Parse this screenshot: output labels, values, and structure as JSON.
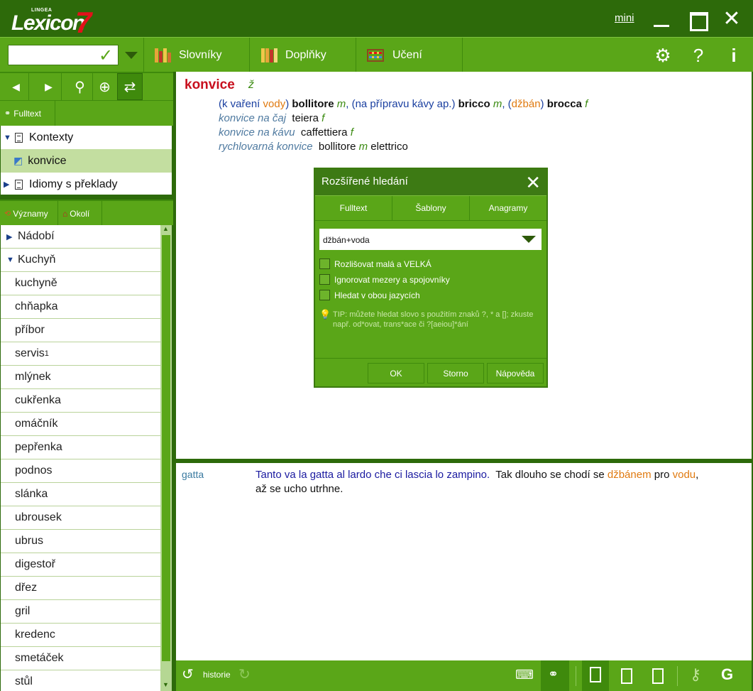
{
  "window": {
    "logo_brand": "LINGEA",
    "logo_name": "Lexicon",
    "logo_version": "7",
    "mini_label": "mini",
    "close_glyph": "✕"
  },
  "toolbar": {
    "search_value": "",
    "dictionaries_label": "Slovníky",
    "addons_label": "Doplňky",
    "learning_label": "Učení",
    "settings_icon": "gear-icon",
    "help_label": "?",
    "info_label": "i"
  },
  "left": {
    "fulltext_tab": "Fulltext",
    "contexts": [
      {
        "label": "Kontexty",
        "state": "expanded"
      },
      {
        "label": "konvice",
        "state": "selected"
      },
      {
        "label": "Idiomy s překlady",
        "state": "collapsed"
      }
    ],
    "meanings_tab": "Významy",
    "surroundings_tab": "Okolí",
    "words": [
      {
        "label": "Nádobí",
        "type": "category",
        "expanded": false
      },
      {
        "label": "Kuchyň",
        "type": "category",
        "expanded": true
      },
      {
        "label": "kuchyně"
      },
      {
        "label": "chňapka"
      },
      {
        "label": "příbor"
      },
      {
        "label": "servis",
        "sup": "1"
      },
      {
        "label": "mlýnek"
      },
      {
        "label": "cukřenka"
      },
      {
        "label": "omáčník"
      },
      {
        "label": "pepřenka"
      },
      {
        "label": "podnos"
      },
      {
        "label": "slánka"
      },
      {
        "label": "ubrousek"
      },
      {
        "label": "ubrus"
      },
      {
        "label": "digestoř"
      },
      {
        "label": "dřez"
      },
      {
        "label": "gril"
      },
      {
        "label": "kredenc"
      },
      {
        "label": "smetáček"
      },
      {
        "label": "stůl"
      }
    ]
  },
  "entry": {
    "headword": "konvice",
    "gender": "ž",
    "line1": {
      "p1": "(k vaření ",
      "p2": "vody",
      "p3": ") ",
      "w1": "bollitore",
      "g1": "m",
      "p4": ", (na přípravu kávy ap.) ",
      "w2": "bricco",
      "g2": "m",
      "p5": ", (",
      "p6": "džbán",
      "p7": ") ",
      "w3": "brocca",
      "g3": "f"
    },
    "phrases": [
      {
        "phrase": "konvice na čaj",
        "translation": "teiera",
        "gender": "f",
        "extra": ""
      },
      {
        "phrase": "konvice na kávu",
        "translation": "caffettiera",
        "gender": "f",
        "extra": ""
      },
      {
        "phrase": "rychlovarná konvice",
        "translation": "bollitore",
        "gender": "m",
        "extra": "elettrico"
      }
    ]
  },
  "result": {
    "keyword": "gatta",
    "italian": "Tanto va la gatta al lardo che ci lascia lo zampino.",
    "czech_1": "Tak dlouho se chodí se ",
    "czech_hl1": "džbánem",
    "czech_2": " pro ",
    "czech_hl2": "vodu",
    "czech_3": ",",
    "czech_line2": "až se ucho utrhne."
  },
  "dialog": {
    "title": "Rozšířené hledání",
    "close_glyph": "✕",
    "tabs": [
      "Fulltext",
      "Šablony",
      "Anagramy"
    ],
    "active_tab": "Šablony",
    "query": "džbán+voda",
    "options": [
      {
        "label": "Rozlišovat malá a VELKÁ",
        "checked": false
      },
      {
        "label": "Ignorovat mezery a spojovníky",
        "checked": false
      },
      {
        "label": "Hledat v obou jazycích",
        "checked": false
      }
    ],
    "tip": "TIP: můžete hledat slovo s použitím znaků ?, * a []; zkuste např. od*ovat, trans*ace či ?[aeiou]*ání",
    "ok_label": "OK",
    "cancel_label": "Storno",
    "help_label": "Nápověda"
  },
  "bottom": {
    "history_label": "historie",
    "g_label": "G"
  },
  "colors": {
    "frame": "#2d6a0a",
    "toolbar": "#5aa618",
    "headword": "#c8101e",
    "highlight": "#e07a10",
    "gender": "#3a8a10",
    "italian": "#1a1aa0"
  }
}
